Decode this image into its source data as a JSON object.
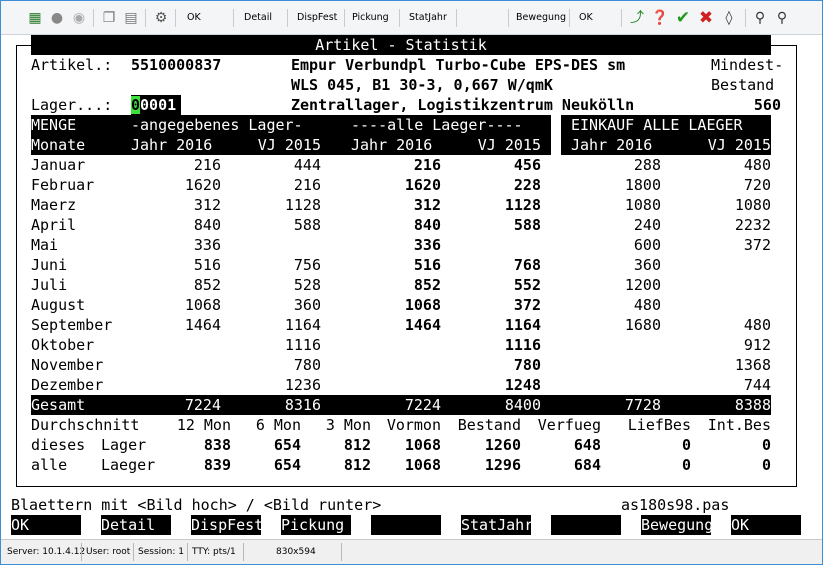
{
  "toolbar": {
    "buttons": [
      "OK",
      "Detail",
      "DispFest",
      "Pickung",
      "StatJahr",
      "Bewegung",
      "OK"
    ]
  },
  "screen": {
    "title": "Artikel - Statistik",
    "artikel_label": "Artikel.:",
    "artikel_nr": "5510000837",
    "desc1": "Empur Verbundpl Turbo-Cube EPS-DES sm",
    "desc2": "WLS 045, B1 30-3, 0,667 W/qmK",
    "mindest1": "Mindest-",
    "mindest2": "Bestand",
    "lager_label": "Lager...:",
    "lager_first": "0",
    "lager_rest": "0001",
    "lager_name": "Zentrallager, Logistikzentrum Neukölln",
    "mindest_value": "560",
    "hdr": {
      "menge": "MENGE",
      "angegebenes": "-angegebenes Lager-",
      "alle": "----alle Laeger----",
      "einkauf": "EINKAUF ALLE LAEGER",
      "monate": "Monate",
      "jahr": "Jahr 2016",
      "vj": "VJ 2015"
    },
    "months": [
      {
        "name": "Januar",
        "c1": "216",
        "c2": "444",
        "c3": "216",
        "c4": "456",
        "c5": "288",
        "c6": "480"
      },
      {
        "name": "Februar",
        "c1": "1620",
        "c2": "216",
        "c3": "1620",
        "c4": "228",
        "c5": "1800",
        "c6": "720"
      },
      {
        "name": "Maerz",
        "c1": "312",
        "c2": "1128",
        "c3": "312",
        "c4": "1128",
        "c5": "1080",
        "c6": "1080"
      },
      {
        "name": "April",
        "c1": "840",
        "c2": "588",
        "c3": "840",
        "c4": "588",
        "c5": "240",
        "c6": "2232"
      },
      {
        "name": "Mai",
        "c1": "336",
        "c2": "",
        "c3": "336",
        "c4": "",
        "c5": "600",
        "c6": "372"
      },
      {
        "name": "Juni",
        "c1": "516",
        "c2": "756",
        "c3": "516",
        "c4": "768",
        "c5": "360",
        "c6": ""
      },
      {
        "name": "Juli",
        "c1": "852",
        "c2": "528",
        "c3": "852",
        "c4": "552",
        "c5": "1200",
        "c6": ""
      },
      {
        "name": "August",
        "c1": "1068",
        "c2": "360",
        "c3": "1068",
        "c4": "372",
        "c5": "480",
        "c6": ""
      },
      {
        "name": "September",
        "c1": "1464",
        "c2": "1164",
        "c3": "1464",
        "c4": "1164",
        "c5": "1680",
        "c6": "480"
      },
      {
        "name": "Oktober",
        "c1": "",
        "c2": "1116",
        "c3": "",
        "c4": "1116",
        "c5": "",
        "c6": "912"
      },
      {
        "name": "November",
        "c1": "",
        "c2": "780",
        "c3": "",
        "c4": "780",
        "c5": "",
        "c6": "1368"
      },
      {
        "name": "Dezember",
        "c1": "",
        "c2": "1236",
        "c3": "",
        "c4": "1248",
        "c5": "",
        "c6": "744"
      }
    ],
    "gesamt": {
      "name": "Gesamt",
      "c1": "7224",
      "c2": "8316",
      "c3": "7224",
      "c4": "8400",
      "c5": "7728",
      "c6": "8388"
    },
    "summary_hdr": [
      "Durchschnitt",
      "12 Mon",
      "6 Mon",
      "3 Mon",
      "Vormon",
      "Bestand",
      "Verfueg",
      "LiefBes",
      "Int.Bes"
    ],
    "summary_rows": [
      {
        "a": "dieses",
        "b": "Lager",
        "v": [
          "838",
          "654",
          "812",
          "1068",
          "1260",
          "648",
          "0",
          "0"
        ]
      },
      {
        "a": "alle",
        "b": "Laeger",
        "v": [
          "839",
          "654",
          "812",
          "1068",
          "1296",
          "684",
          "0",
          "0"
        ]
      }
    ],
    "blaettern": "Blaettern mit <Bild hoch> / <Bild runter>",
    "program": "as180s98.pas",
    "fkeys": [
      "OK",
      "Detail",
      "DispFest",
      "Pickung",
      "",
      "StatJahr",
      "",
      "Bewegung",
      "OK"
    ]
  },
  "status": {
    "server": "Server:  10.1.4.12",
    "user": "User:  root",
    "session": "Session:  1",
    "tty": "TTY:  pts/1",
    "size": "830x594"
  },
  "colors": {
    "cursor": "#3de03d",
    "frame_blue": "#3c8fd6"
  }
}
